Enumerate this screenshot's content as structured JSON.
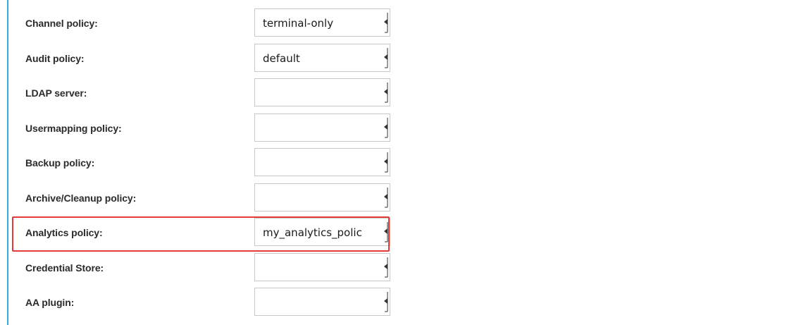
{
  "form": {
    "rows": [
      {
        "label": "Channel policy:",
        "value": "terminal-only"
      },
      {
        "label": "Audit policy:",
        "value": "default"
      },
      {
        "label": "LDAP server:",
        "value": ""
      },
      {
        "label": "Usermapping policy:",
        "value": ""
      },
      {
        "label": "Backup policy:",
        "value": ""
      },
      {
        "label": "Archive/Cleanup policy:",
        "value": ""
      },
      {
        "label": "Analytics policy:",
        "value": "my_analytics_polic"
      },
      {
        "label": "Credential Store:",
        "value": ""
      },
      {
        "label": "AA plugin:",
        "value": ""
      }
    ]
  },
  "colors": {
    "accent_bar": "#3aa9d6",
    "highlight": "#e53935",
    "label_text": "#2b2b2b"
  }
}
